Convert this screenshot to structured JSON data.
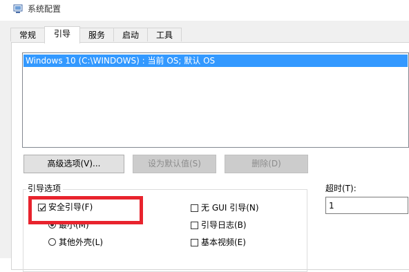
{
  "window": {
    "title": "系统配置",
    "icon": "system-config-icon"
  },
  "tabs": [
    {
      "label": "常规",
      "active": false
    },
    {
      "label": "引导",
      "active": true
    },
    {
      "label": "服务",
      "active": false
    },
    {
      "label": "启动",
      "active": false
    },
    {
      "label": "工具",
      "active": false
    }
  ],
  "os_list": {
    "selected_entry": "Windows 10 (C:\\WINDOWS) : 当前 OS; 默认 OS"
  },
  "buttons": {
    "advanced": "高级选项(V)...",
    "set_default": "设为默认值(S)",
    "delete": "删除(D)"
  },
  "boot_options": {
    "legend": "引导选项",
    "safe_boot": {
      "label": "安全引导(F)",
      "checked": true
    },
    "minimal": {
      "label": "最小(M)",
      "selected": true
    },
    "alternate_shell": {
      "label": "其他外壳(L)",
      "selected": false
    },
    "no_gui_boot": {
      "label": "无 GUI 引导(N)",
      "checked": false
    },
    "boot_log": {
      "label": "引导日志(B)",
      "checked": false
    },
    "base_video": {
      "label": "基本视频(E)",
      "checked": false
    }
  },
  "timeout": {
    "label": "超时(T):",
    "value": "1"
  },
  "colors": {
    "selection": "#3399ff",
    "highlight_box": "#e8232d"
  }
}
